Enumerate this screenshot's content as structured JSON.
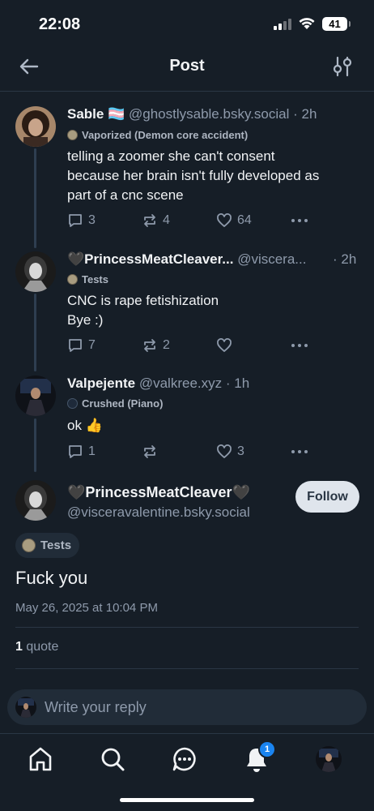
{
  "status_bar": {
    "time": "22:08",
    "battery": "41"
  },
  "header": {
    "title": "Post"
  },
  "posts": [
    {
      "name": "Sable",
      "flag": "🏳️‍⚧️",
      "handle": "@ghostlysable.bsky.social",
      "time": "· 2h",
      "badge": "Vaporized (Demon core accident)",
      "text_lines": [
        "telling a zoomer she can't consent",
        "because her brain isn't fully developed as",
        "part of a cnc scene"
      ],
      "replies": "3",
      "reposts": "4",
      "likes": "64"
    },
    {
      "name": "🖤PrincessMeatCleaver...",
      "handle": "@viscera...",
      "time": "· 2h",
      "badge": "Tests",
      "text_lines": [
        "CNC is rape fetishization",
        "Bye :)"
      ],
      "replies": "7",
      "reposts": "2",
      "likes": ""
    },
    {
      "name": "Valpejente",
      "handle": "@valkree.xyz",
      "time": "· 1h",
      "badge": "Crushed (Piano)",
      "text_lines": [
        "ok 👍"
      ],
      "replies": "1",
      "reposts": "",
      "likes": "3"
    }
  ],
  "main_post": {
    "name": "🖤PrincessMeatCleaver🖤",
    "handle": "@visceravalentine.bsky.social",
    "follow_label": "Follow",
    "badge": "Tests",
    "text": "Fuck you",
    "date": "May 26, 2025 at 10:04 PM",
    "quote_count": "1",
    "quote_label": " quote"
  },
  "reply_bar": {
    "placeholder": "Write your reply"
  },
  "tabbar": {
    "notification_count": "1"
  },
  "colors": {
    "accent": "#1a84f0",
    "background": "#161e27",
    "muted": "#8e9aab"
  }
}
